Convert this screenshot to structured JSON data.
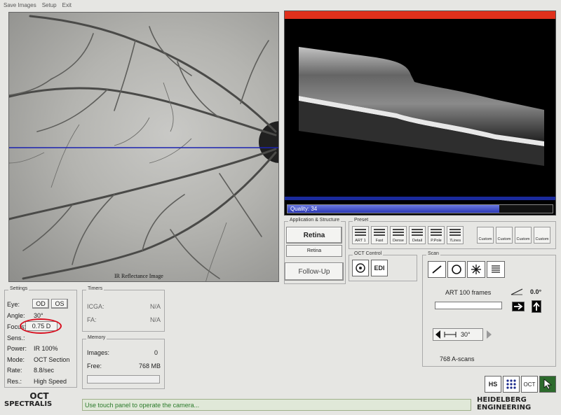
{
  "menu": {
    "items": [
      "Save Images",
      "Setup",
      "Exit"
    ]
  },
  "fundus": {
    "caption": "IR Reflectance Image"
  },
  "oct": {
    "quality_label": "Quality: 34",
    "quality_value": 34,
    "quality_fill_fraction": 0.8
  },
  "application": {
    "title": "Application & Structure",
    "primary": "Retina",
    "secondary": "Retina",
    "follow_up": "Follow-Up"
  },
  "preset": {
    "title": "Preset",
    "items": [
      "ART 1",
      "Fast",
      "Dense",
      "Detail",
      "P.Pole",
      "7Lines"
    ],
    "custom": [
      "Custom",
      "Custom",
      "Custom",
      "Custom"
    ]
  },
  "oct_control": {
    "title": "OCT Control",
    "edi": "EDI"
  },
  "scan": {
    "title": "Scan",
    "art_frames": "ART 100 frames",
    "angle_value": "0.0°",
    "angle_degrees": "30°",
    "a_scans": "768 A-scans"
  },
  "settings": {
    "title": "Settings",
    "rows": [
      {
        "label": "Eye:",
        "value": ""
      },
      {
        "label": "Angle:",
        "value": "30°"
      },
      {
        "label": "Focus:",
        "value": "0.75 D"
      },
      {
        "label": "Sens.:",
        "value": ""
      },
      {
        "label": "Power:",
        "value": "IR  100%"
      },
      {
        "label": "Mode:",
        "value": "OCT Section"
      },
      {
        "label": "Rate:",
        "value": "8.8/sec"
      },
      {
        "label": "Res.:",
        "value": "High Speed"
      }
    ],
    "eye_od": "OD",
    "eye_os": "OS"
  },
  "timers": {
    "title": "Timers",
    "icga_label": "ICGA:",
    "icga_value": "N/A",
    "fa_label": "FA:",
    "fa_value": "N/A"
  },
  "memory": {
    "title": "Memory",
    "images_label": "Images:",
    "images_value": "0",
    "free_label": "Free:",
    "free_value": "768 MB"
  },
  "bottom_buttons": {
    "hs": "HS",
    "oct": "OCT"
  },
  "status": {
    "message": "Use touch panel to operate the camera..."
  },
  "logos": {
    "oct_line1": "OCT",
    "oct_line2": "SPECTRALIS",
    "he_line1": "HEIDELBERG",
    "he_line2": "ENGINEERING"
  },
  "colors": {
    "status_text": "#2a7a2a",
    "red_bar": "#e0301c",
    "blue_bar": "#1a2a9c",
    "scan_line": "#1a22b0"
  }
}
